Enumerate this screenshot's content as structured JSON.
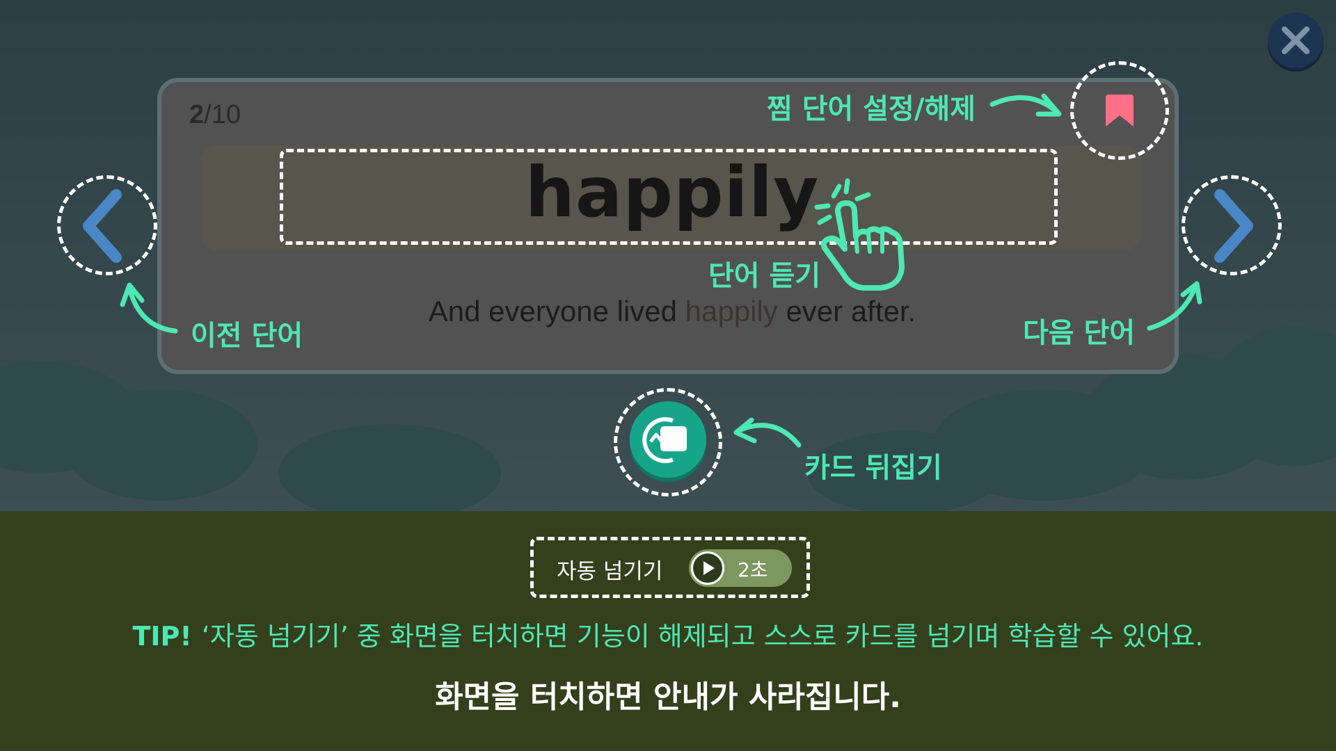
{
  "progress": {
    "current": "2",
    "separator": "/",
    "total": "10"
  },
  "card": {
    "word": "happily",
    "sentence_before": "And everyone lived ",
    "sentence_highlight": "happily",
    "sentence_after": " ever after."
  },
  "guide": {
    "bookmark_label": "찜 단어 설정/해제",
    "listen_label": "단어 듣기",
    "prev_label": "이전 단어",
    "next_label": "다음 단어",
    "flip_label": "카드 뒤집기"
  },
  "auto_advance": {
    "label": "자동 넘기기",
    "seconds": "2초"
  },
  "tip": {
    "prefix": "TIP!",
    "text": "‘자동 넘기기’ 중 화면을 터치하면 기능이 해제되고 스스로 카드를 넘기며 학습할 수 있어요."
  },
  "dismiss_text": "화면을 터치하면 안내가 사라집니다.",
  "icons": {
    "close": "close-icon",
    "bookmark": "bookmark-icon",
    "prev": "chevron-left-icon",
    "next": "chevron-right-icon",
    "flip": "flip-card-icon",
    "touch": "tap-hand-icon",
    "play": "play-icon"
  },
  "colors": {
    "accent": "#4ee8b4",
    "nav_arrow": "#4a87c7",
    "bookmark": "#ff6f86",
    "flip_button": "#17a58a",
    "close_button": "#1d3550"
  }
}
